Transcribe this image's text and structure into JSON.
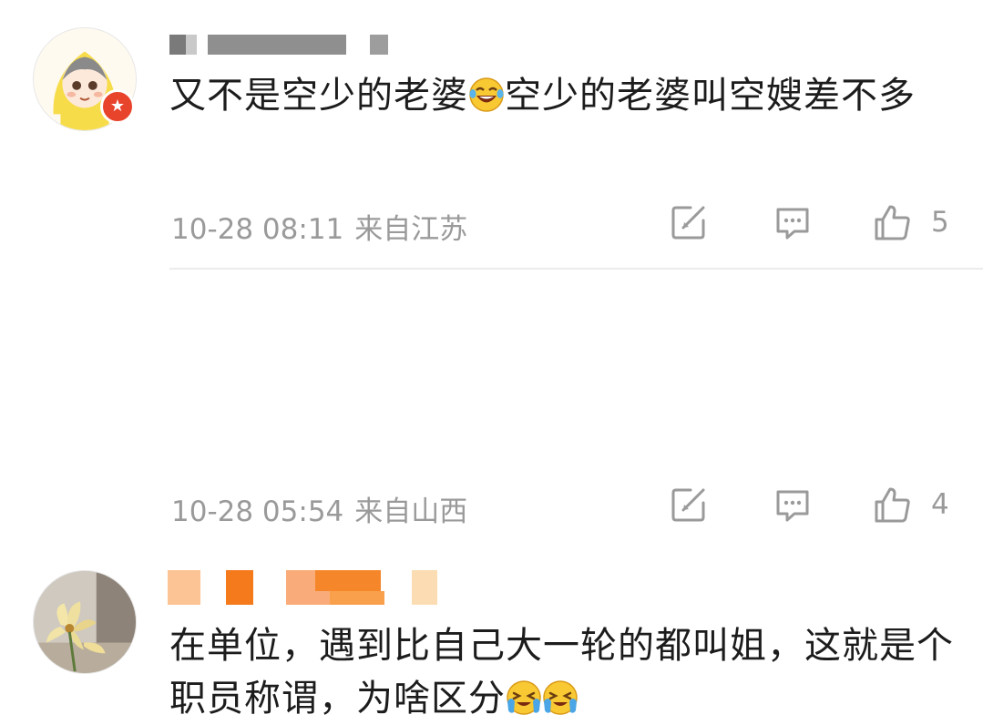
{
  "comments": [
    {
      "username_hidden": true,
      "verified": true,
      "text_parts": [
        "又不是空少的老婆",
        "空少的老婆叫空嫂差不多"
      ],
      "emojis": [
        "laughing-tears-emoji"
      ],
      "time": "10-28 08:11",
      "location": "来自江苏",
      "likes": "5"
    },
    {
      "username_hidden": true,
      "verified": false,
      "text": "在单位，遇到比自己大一轮的都叫姐，这就是个职员称谓，为啥区分",
      "emojis": [
        "crying-laughing-emoji",
        "crying-laughing-emoji"
      ],
      "time": "10-28 05:54",
      "location": "来自山西",
      "likes": "4"
    }
  ],
  "icons": {
    "repost": "repost-icon",
    "reply": "comment-icon",
    "like": "thumbs-up-icon"
  },
  "colors": {
    "meta_gray": "#9a9a9a",
    "badge_red": "#e8432b",
    "mask_orange": "#f6862a"
  }
}
